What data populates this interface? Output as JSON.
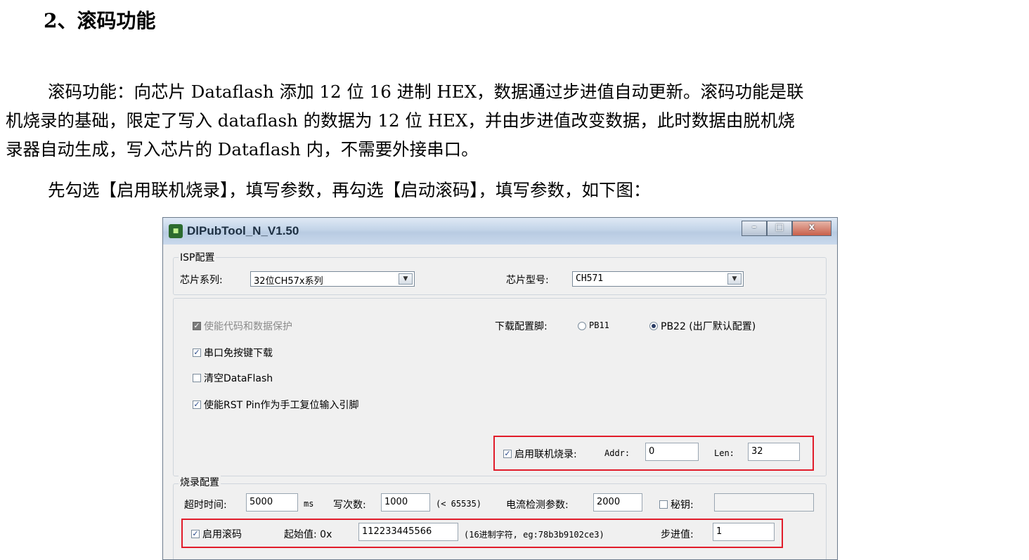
{
  "heading": "2、滚码功能",
  "paragraph1_lines": [
    "滚码功能：向芯片 Dataflash 添加 12 位 16 进制 HEX，数据通过步进值自动更新。滚码功能是联",
    "机烧录的基础，限定了写入 dataflash 的数据为 12 位 HEX，并由步进值改变数据，此时数据由脱机烧",
    "录器自动生成，写入芯片的 Dataflash 内，不需要外接串口。"
  ],
  "paragraph2": "先勾选【启用联机烧录】，填写参数，再勾选【启动滚码】，填写参数，如下图：",
  "window": {
    "title": "DlPubTool_N_V1.50",
    "buttons": {
      "minimize": "–",
      "maximize": "□",
      "close": "x"
    },
    "isp_group": {
      "legend": "ISP配置",
      "chip_series_label": "芯片系列:",
      "chip_series_value": "32位CH57x系列",
      "chip_model_label": "芯片型号:",
      "chip_model_value": "CH571",
      "checkboxes": [
        {
          "label": "使能代码和数据保护",
          "checked": true,
          "disabled": true
        },
        {
          "label": "串口免按键下载",
          "checked": true,
          "disabled": false
        },
        {
          "label": "清空DataFlash",
          "checked": false,
          "disabled": false
        },
        {
          "label": "使能RST Pin作为手工复位输入引脚",
          "checked": true,
          "disabled": false
        }
      ],
      "download_pin_label": "下载配置脚:",
      "pin_options": [
        {
          "label": "PB11",
          "selected": false
        },
        {
          "label": "PB22 (出厂默认配置)",
          "selected": true
        }
      ],
      "online_burn": {
        "label": "启用联机烧录:",
        "checked": true,
        "addr_label": "Addr:",
        "addr_value": "0",
        "len_label": "Len:",
        "len_value": "32"
      }
    },
    "burn_group": {
      "legend": "烧录配置",
      "timeout_label": "超时时间:",
      "timeout_value": "5000",
      "timeout_unit": "ms",
      "write_count_label": "写次数:",
      "write_count_value": "1000",
      "write_count_hint": "(< 65535)",
      "current_label": "电流检测参数:",
      "current_value": "2000",
      "key_label": "秘钥:",
      "key_checked": false,
      "key_value": "",
      "rolling": {
        "label": "启用滚码",
        "checked": true,
        "start_label": "起始值: 0x",
        "start_value": "112233445566",
        "hint": "(16进制字符, eg:78b3b9102ce3)",
        "step_label": "步进值:",
        "step_value": "1"
      }
    }
  },
  "colors": {
    "highlight": "#e11c2a",
    "check": "#2b4a8a"
  }
}
